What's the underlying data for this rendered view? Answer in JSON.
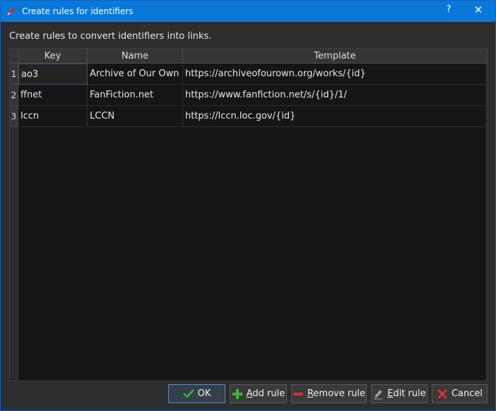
{
  "window": {
    "title": "Create rules for identifiers",
    "help_glyph": "?",
    "close_glyph": "✕"
  },
  "intro": "Create rules to convert identifiers into links.",
  "table": {
    "columns": [
      "Key",
      "Name",
      "Template"
    ],
    "rows": [
      {
        "num": "1",
        "key": "ao3",
        "name": "Archive of Our Own",
        "template": "https://archiveofourown.org/works/{id}"
      },
      {
        "num": "2",
        "key": "ffnet",
        "name": "FanFiction.net",
        "template": "https://www.fanfiction.net/s/{id}/1/"
      },
      {
        "num": "3",
        "key": "lccn",
        "name": "LCCN",
        "template": "https://lccn.loc.gov/{id}"
      }
    ]
  },
  "buttons": {
    "ok": {
      "label": "OK",
      "icon": "checkmark-icon",
      "color": "#3cb43c"
    },
    "add": {
      "mnemonic": "A",
      "rest": "dd rule",
      "icon": "plus-icon",
      "color": "#3cb43c"
    },
    "remove": {
      "mnemonic": "R",
      "rest": "emove rule",
      "icon": "minus-icon",
      "color": "#d83030"
    },
    "edit": {
      "mnemonic": "E",
      "rest": "dit rule",
      "icon": "pencil-icon"
    },
    "cancel": {
      "label": "Cancel",
      "icon": "cancel-x-icon",
      "color": "#d83030"
    }
  },
  "colors": {
    "titlebar": "#0a78d7",
    "dialog_bg": "#2d2d2d",
    "table_bg": "#151515"
  }
}
